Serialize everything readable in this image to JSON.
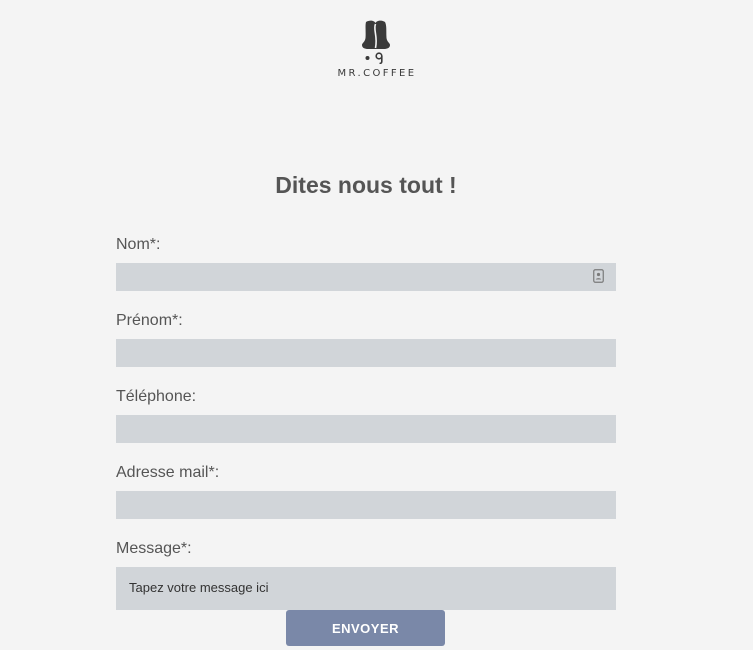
{
  "brand": {
    "logo_icon": "coffee-bean-bell-logo",
    "name": "MR.COFFEE"
  },
  "form": {
    "title": "Dites nous tout !",
    "fields": [
      {
        "label": "Nom*:",
        "value": "",
        "icon": "contact-card-icon"
      },
      {
        "label": "Prénom*:",
        "value": ""
      },
      {
        "label": "Téléphone:",
        "value": ""
      },
      {
        "label": "Adresse mail*:",
        "value": ""
      }
    ],
    "message": {
      "label": "Message*:",
      "placeholder": "Tapez votre message ici"
    },
    "submit_label": "ENVOYER"
  },
  "colors": {
    "background": "#f4f4f4",
    "input_background": "#d1d5d9",
    "text": "#555555",
    "button": "#7a88a8",
    "button_text": "#ffffff"
  }
}
